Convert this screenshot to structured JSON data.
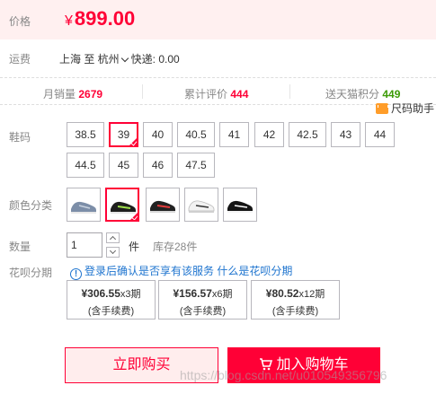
{
  "price": {
    "label": "价格",
    "currency": "¥",
    "value": "899.00"
  },
  "shipping": {
    "label": "运费",
    "text": "上海  至  杭州",
    "suffix": "快递: 0.00"
  },
  "stats": {
    "monthly_sales_label": "月销量",
    "monthly_sales": "2679",
    "reviews_label": "累计评价",
    "reviews": "444",
    "points_label": "送天猫积分",
    "points": "449"
  },
  "size_helper": "尺码助手",
  "sizes": {
    "label": "鞋码",
    "options": [
      "38.5",
      "39",
      "40",
      "40.5",
      "41",
      "42",
      "42.5",
      "43",
      "44",
      "44.5",
      "45",
      "46",
      "47.5"
    ],
    "selected": "39"
  },
  "colors": {
    "label": "颜色分类",
    "options": [
      "blue-grey-shoe",
      "black-green-shoe",
      "black-red-shoe",
      "white-shoe",
      "black-white-shoe"
    ],
    "selected": "black-green-shoe"
  },
  "quantity": {
    "label": "数量",
    "value": "1",
    "unit": "件",
    "stock": "库存28件"
  },
  "huabei": {
    "label": "花呗分期",
    "note_text": "登录后确认是否享有该服务",
    "note_link": "什么是花呗分期",
    "plans": [
      {
        "amount": "¥306.55",
        "periods": "x3期",
        "fee": "(含手续费)"
      },
      {
        "amount": "¥156.57",
        "periods": "x6期",
        "fee": "(含手续费)"
      },
      {
        "amount": "¥80.52",
        "periods": "x12期",
        "fee": "(含手续费)"
      }
    ]
  },
  "buttons": {
    "buy_now": "立即购买",
    "add_to_cart": "加入购物车"
  },
  "watermark": "https://blog.csdn.net/u010549356796",
  "colors_theme": {
    "accent": "#ff0036",
    "green": "#3c9b06",
    "link": "#1e74cf",
    "price_bg": "#fff0f0"
  }
}
